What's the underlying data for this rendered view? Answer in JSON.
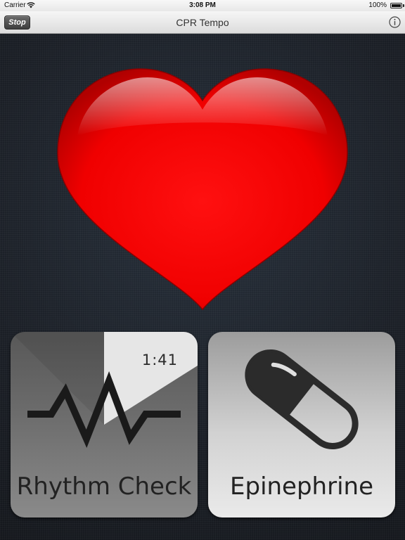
{
  "status_bar": {
    "carrier": "Carrier",
    "time": "3:08 PM",
    "battery_percent": "100%",
    "icons": [
      "wifi-icon",
      "battery-icon"
    ]
  },
  "nav_bar": {
    "stop_label": "Stop",
    "title": "CPR Tempo",
    "info_icon": "info-icon"
  },
  "heart": {
    "icon": "heart-icon",
    "color": "#ff0000"
  },
  "tiles": {
    "rhythm_check": {
      "label": "Rhythm Check",
      "timer": "1:41",
      "icon": "heartbeat-waveform-icon"
    },
    "epinephrine": {
      "label": "Epinephrine",
      "icon": "pill-capsule-icon"
    }
  }
}
